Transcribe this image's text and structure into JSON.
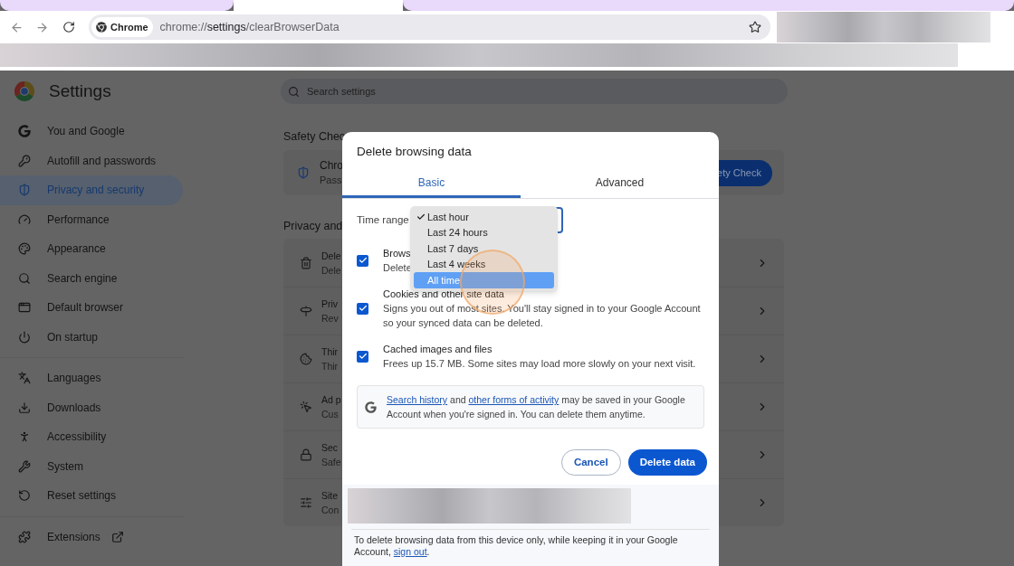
{
  "browser": {
    "tabs": [
      {
        "selected": false
      },
      {
        "selected": true
      },
      {
        "selected": false
      }
    ],
    "chip": "Chrome",
    "url": "chrome://**settings**/clearBrowserData"
  },
  "settings": {
    "title": "Settings",
    "search": {
      "placeholder": "Search settings"
    },
    "sidebar": {
      "groups": [
        [
          {
            "label": "You and Google",
            "selected": false
          },
          {
            "label": "Autofill and passwords",
            "selected": false
          },
          {
            "label": "Privacy and security",
            "selected": true
          },
          {
            "label": "Performance",
            "selected": false
          },
          {
            "label": "Appearance",
            "selected": false
          },
          {
            "label": "Search engine",
            "selected": false
          },
          {
            "label": "Default browser",
            "selected": false
          },
          {
            "label": "On startup",
            "selected": false
          }
        ],
        [
          {
            "label": "Languages",
            "selected": false
          },
          {
            "label": "Downloads",
            "selected": false
          },
          {
            "label": "Accessibility",
            "selected": false
          },
          {
            "label": "System",
            "selected": false
          },
          {
            "label": "Reset settings",
            "selected": false
          }
        ],
        [
          {
            "label": "Extensions",
            "selected": false
          }
        ]
      ]
    },
    "safety_check": {
      "heading": "Safety Chec",
      "title": "Chro",
      "subtitle": "Pass",
      "button": "ety Check"
    },
    "privacy": {
      "heading": "Privacy and",
      "rows": [
        {
          "title": "Dele",
          "subtitle": "Dele"
        },
        {
          "title": "Priv",
          "subtitle": "Rev"
        },
        {
          "title": "Thir",
          "subtitle": "Thir"
        },
        {
          "title": "Ad p",
          "subtitle": "Cus"
        },
        {
          "title": "Sec",
          "subtitle": "Safe"
        },
        {
          "title": "Site",
          "subtitle": "Con"
        }
      ]
    }
  },
  "dialog": {
    "title": "Delete browsing data",
    "tabs": [
      {
        "label": "Basic",
        "selected": true
      },
      {
        "label": "Advanced",
        "selected": false
      }
    ],
    "time_range": {
      "label": "Time range",
      "options": [
        {
          "label": "Last hour",
          "checked": true,
          "highlighted": false
        },
        {
          "label": "Last 24 hours",
          "checked": false,
          "highlighted": false
        },
        {
          "label": "Last 7 days",
          "checked": false,
          "highlighted": false
        },
        {
          "label": "Last 4 weeks",
          "checked": false,
          "highlighted": false
        },
        {
          "label": "All time",
          "checked": false,
          "highlighted": true
        }
      ]
    },
    "items": [
      {
        "title": "Brows",
        "description": "Delete",
        "checked": true
      },
      {
        "title": "Cookies and other site data",
        "description": "Signs you out of most sites. You'll stay signed in to your Google Account so your synced data can be deleted.",
        "checked": true
      },
      {
        "title": "Cached images and files",
        "description": "Frees up 15.7 MB. Some sites may load more slowly on your next visit.",
        "checked": true
      }
    ],
    "notice": [
      {
        "kind": "link",
        "text": "Search history"
      },
      {
        "kind": "text",
        "text": " and "
      },
      {
        "kind": "link",
        "text": "other forms of activity"
      },
      {
        "kind": "text",
        "text": " may be saved in your Google Account when you're signed in. You can delete them anytime."
      }
    ],
    "buttons": [
      {
        "label": "Cancel",
        "kind": "secondary"
      },
      {
        "label": "Delete data",
        "kind": "primary"
      }
    ],
    "footer": [
      {
        "kind": "text",
        "text": "To delete browsing data from this device only, while keeping it in your Google Account, "
      },
      {
        "kind": "link",
        "text": "sign out"
      },
      {
        "kind": "text",
        "text": "."
      }
    ]
  }
}
